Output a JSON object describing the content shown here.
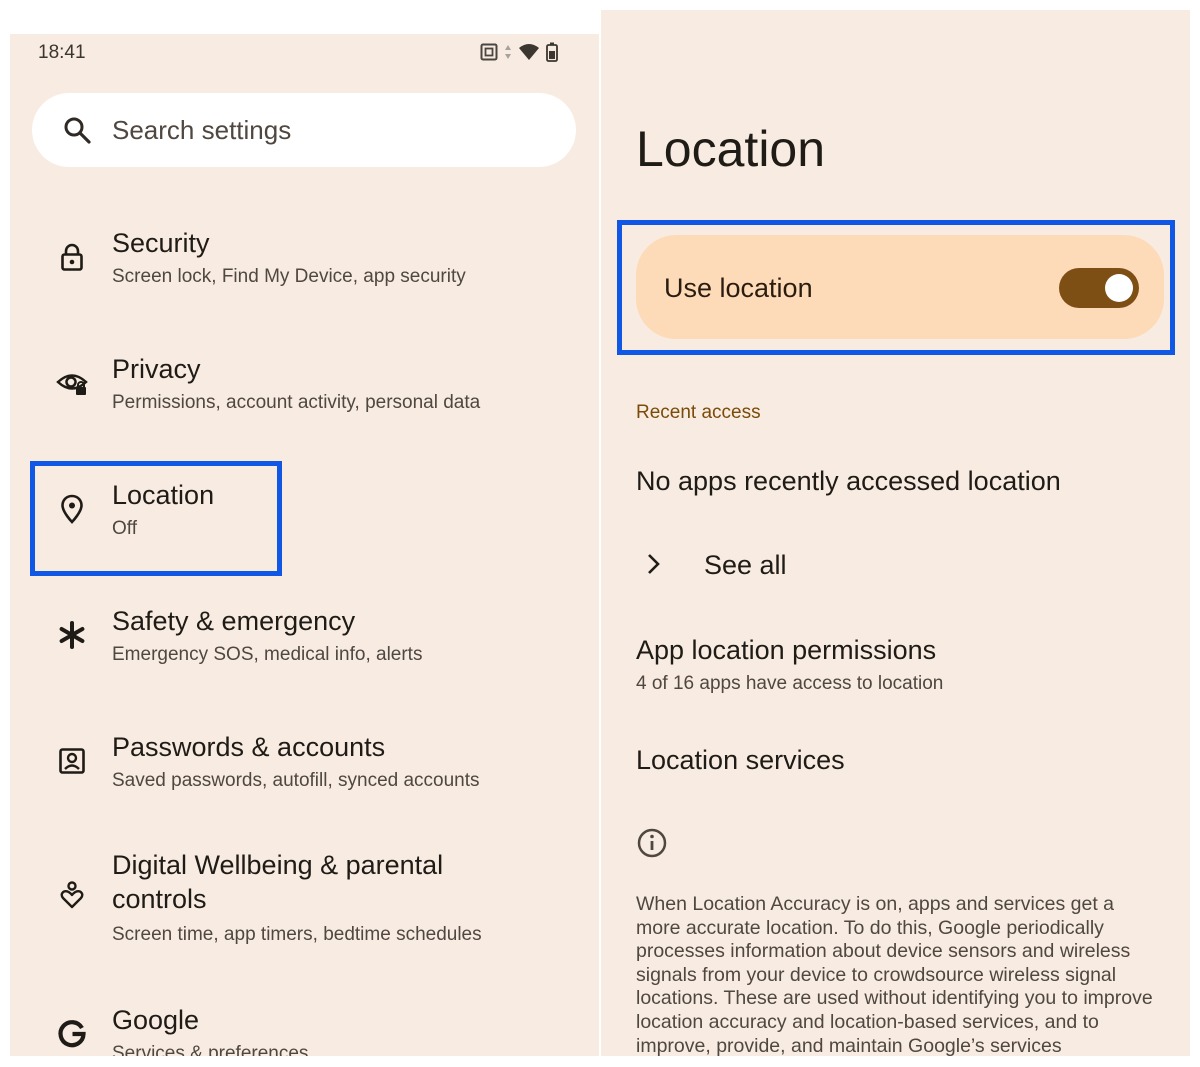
{
  "status_bar": {
    "time": "18:41"
  },
  "search": {
    "placeholder": "Search settings"
  },
  "settings_list": [
    {
      "title": "Security",
      "subtitle": "Screen lock, Find My Device, app security",
      "icon": "lock-icon"
    },
    {
      "title": "Privacy",
      "subtitle": "Permissions, account activity, personal data",
      "icon": "privacy-eye-icon"
    },
    {
      "title": "Location",
      "subtitle": "Off",
      "icon": "location-pin-icon"
    },
    {
      "title": "Safety & emergency",
      "subtitle": "Emergency SOS, medical info, alerts",
      "icon": "asterisk-icon"
    },
    {
      "title": "Passwords & accounts",
      "subtitle": "Saved passwords, autofill, synced accounts",
      "icon": "account-box-icon"
    },
    {
      "title_line1": "Digital Wellbeing & parental",
      "title_line2": "controls",
      "subtitle": "Screen time, app timers, bedtime schedules",
      "icon": "wellbeing-icon"
    },
    {
      "title": "Google",
      "subtitle": "Services & preferences",
      "icon": "google-g-icon"
    }
  ],
  "location_page": {
    "title": "Location",
    "use_location_label": "Use location",
    "use_location_on": true,
    "recent_access_header": "Recent access",
    "no_recent": "No apps recently accessed location",
    "see_all": "See all",
    "app_permissions_title": "App location permissions",
    "app_permissions_sub": "4 of 16 apps have access to location",
    "location_services": "Location services",
    "info_paragraph": "When Location Accuracy is on, apps and services get a more accurate location. To do this, Google periodically processes information about device sensors and wireless signals from your device to crowdsource wireless signal locations. These are used without identifying you to improve location accuracy and location-based services, and to improve, provide, and maintain Google’s services"
  },
  "colors": {
    "background": "#f8ece2",
    "highlight_border": "#1057e5",
    "use_location_card": "#fedbb8",
    "toggle_track": "#7d4f14",
    "section_header": "#7a4b09"
  }
}
